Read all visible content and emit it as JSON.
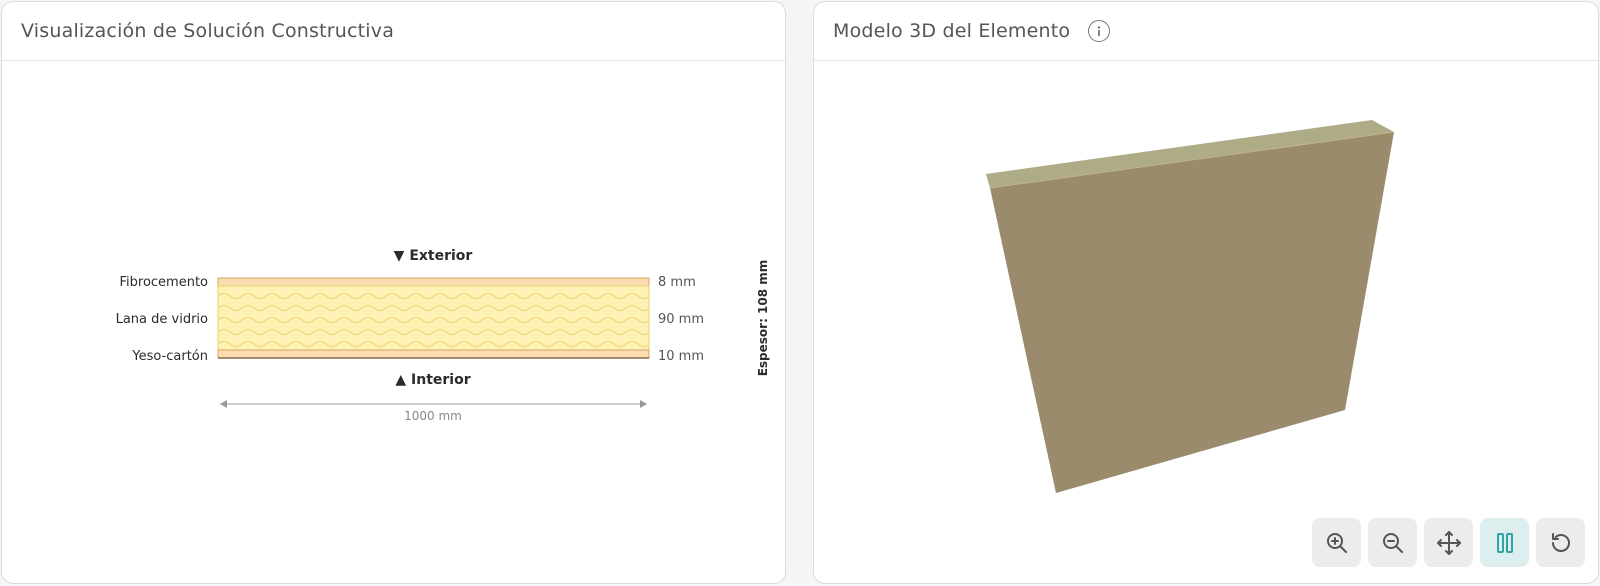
{
  "left_panel": {
    "title": "Visualización de Solución Constructiva",
    "exterior_label": "▼ Exterior",
    "interior_label": "▲ Interior",
    "layers": [
      {
        "name": "Fibrocemento",
        "thickness": "8 mm",
        "fill": "#fbdcae",
        "stroke": "#d8a46a"
      },
      {
        "name": "Lana de vidrio",
        "thickness": "90 mm",
        "fill": "#fdf2b4",
        "stroke": "#e8cf72"
      },
      {
        "name": "Yeso-cartón",
        "thickness": "10 mm",
        "fill": "#fbdcae",
        "stroke": "#d8a46a"
      }
    ],
    "total_thickness_label": "Espesor: 108 mm",
    "width_label": "1000 mm"
  },
  "right_panel": {
    "title": "Modelo 3D del Elemento",
    "info_icon": "info-icon",
    "wall_color": "#9a8b6d",
    "wall_top_color": "#aeab87",
    "toolbar": [
      {
        "name": "zoom-in",
        "icon": "zoom-in-icon",
        "active": false
      },
      {
        "name": "zoom-out",
        "icon": "zoom-out-icon",
        "active": false
      },
      {
        "name": "pan",
        "icon": "move-icon",
        "active": false
      },
      {
        "name": "pause-rotation",
        "icon": "pause-icon",
        "active": true
      },
      {
        "name": "reset-view",
        "icon": "reset-icon",
        "active": false
      }
    ]
  }
}
